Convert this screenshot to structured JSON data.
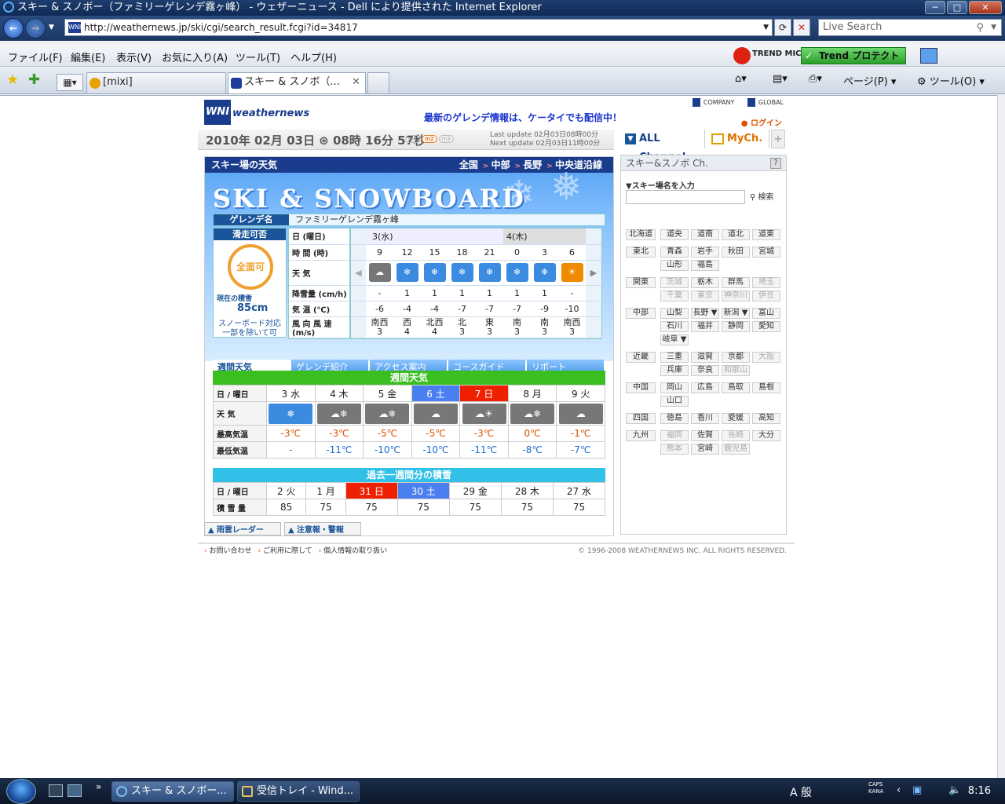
{
  "window": {
    "title": "スキー & スノボー（ファミリーゲレンデ霧ヶ峰） - ウェザーニュース - Dell により提供された Internet Explorer"
  },
  "address": {
    "url": "http://weathernews.jp/ski/cgi/search_result.fcgi?id=34817",
    "search_placeholder": "Live Search"
  },
  "menu": [
    "ファイル(F)",
    "編集(E)",
    "表示(V)",
    "お気に入り(A)",
    "ツール(T)",
    "ヘルプ(H)"
  ],
  "trend": {
    "logo": "TREND MICRO",
    "button": "Trend プロテクト™"
  },
  "tabs": [
    {
      "label": "[mixi]"
    },
    {
      "label": "スキー & スノボ（..."
    }
  ],
  "commands": {
    "page": "ページ(P)",
    "tools": "ツール(O)"
  },
  "page": {
    "logo_text": "weathernews",
    "logo_mark": "WNI",
    "top_links": [
      "COMPANY",
      "GLOBAL"
    ],
    "promo": "最新のゲレンデ情報は、ケータイでも配信中！",
    "login": "ログイン",
    "date": "2010年 02月 03日 ⊛ 08時 16分 57秒",
    "period_tags": [
      "m1",
      "m2",
      "m3"
    ],
    "last_update": "Last update  02月03日08時00分",
    "next_update": "Next update  02月03日11時00分",
    "channels": [
      "ALL Channel",
      "MyCh.",
      "+"
    ],
    "section_title": "スキー場の天気",
    "crumbs": [
      "全国",
      "中部",
      "長野",
      "中央道沿線"
    ],
    "banner_title": "SKI & SNOWBOARD",
    "resort_label": "ゲレンデ名",
    "resort_name": "ファミリーゲレンデ霧ヶ峰",
    "status_label": "滑走可否",
    "status_value": "全面可",
    "snow_label": "現在の積雪",
    "snow_value": "85cm",
    "snowboard": "スノーボード対応 一部を除いて可",
    "forecast": {
      "row_labels": [
        "日 (曜日)",
        "時 間 (時)",
        "天 気",
        "降雪量 (cm/h)",
        "気 温 (℃)",
        "風 向 風 速 (m/s)"
      ],
      "days": [
        "3(水)",
        "4(木)"
      ],
      "hours": [
        "9",
        "12",
        "15",
        "18",
        "21",
        "0",
        "3",
        "6"
      ],
      "weather": [
        "cloud",
        "snow",
        "snow",
        "snow",
        "snow",
        "snow",
        "snow",
        "sun"
      ],
      "snowfall": [
        "-",
        "1",
        "1",
        "1",
        "1",
        "1",
        "1",
        "-"
      ],
      "temp": [
        "-6",
        "-4",
        "-4",
        "-7",
        "-7",
        "-7",
        "-9",
        "-10"
      ],
      "wind_dir": [
        "南西",
        "西",
        "北西",
        "北",
        "東",
        "南",
        "南",
        "南西"
      ],
      "wind_speed": [
        "3",
        "4",
        "4",
        "3",
        "3",
        "3",
        "3",
        "3"
      ]
    },
    "sub_tabs": [
      "週間天気",
      "ゲレンデ紹介",
      "アクセス案内",
      "コースガイド",
      "リポート"
    ],
    "weekly": {
      "title": "週間天気",
      "row_labels": [
        "日 / 曜日",
        "天 気",
        "最高気温",
        "最低気温"
      ],
      "days": [
        "3 水",
        "4 木",
        "5 金",
        "6 土",
        "7 日",
        "8 月",
        "9 火"
      ],
      "weather": [
        "snow",
        "cloud-snow",
        "cloud-snow",
        "cloud",
        "cloud-sun",
        "cloud-snow",
        "cloud"
      ],
      "high": [
        "-3℃",
        "-3℃",
        "-5℃",
        "-5℃",
        "-3℃",
        "0℃",
        "-1℃"
      ],
      "low": [
        "-",
        "-11℃",
        "-10℃",
        "-10℃",
        "-11℃",
        "-8℃",
        "-7℃"
      ]
    },
    "past": {
      "title": "過去一週間分の積雪",
      "row_labels": [
        "日 / 曜日",
        "積 雪 量"
      ],
      "days": [
        "2 火",
        "1 月",
        "31 日",
        "30 土",
        "29 金",
        "28 木",
        "27 水"
      ],
      "values": [
        "85",
        "75",
        "75",
        "75",
        "75",
        "75",
        "75"
      ]
    },
    "footer_buttons": [
      "雨雲レーダー",
      "注意報・警報"
    ],
    "footer_links": [
      "お問い合わせ",
      "ご利用に際して",
      "個人情報の取り扱い"
    ],
    "copyright": "© 1996-2008 WEATHERNEWS INC. ALL RIGHTS RESERVED.",
    "side": {
      "title": "スキー&スノボ Ch.",
      "help": "?",
      "search_label": "▼スキー場名を入力",
      "search_button": "検索",
      "regions": [
        {
          "name": "北海道",
          "prefs": [
            "道央",
            "道南",
            "道北",
            "道東"
          ]
        },
        {
          "name": "東北",
          "prefs": [
            "青森",
            "岩手",
            "秋田",
            "宮城",
            "山形",
            "福島"
          ]
        },
        {
          "name": "関東",
          "prefs": [
            "茨城",
            "栃木",
            "群馬",
            "埼玉",
            "千葉",
            "東京",
            "神奈川",
            "伊豆"
          ]
        },
        {
          "name": "中部",
          "prefs": [
            "山梨",
            "長野 ▼",
            "新潟 ▼",
            "富山",
            "石川",
            "福井",
            "静岡",
            "愛知",
            "岐阜 ▼"
          ]
        },
        {
          "name": "近畿",
          "prefs": [
            "三重",
            "滋賀",
            "京都",
            "大阪",
            "兵庫",
            "奈良",
            "和歌山"
          ]
        },
        {
          "name": "中国",
          "prefs": [
            "岡山",
            "広島",
            "鳥取",
            "島根",
            "山口"
          ]
        },
        {
          "name": "四国",
          "prefs": [
            "徳島",
            "香川",
            "愛媛",
            "高知"
          ]
        },
        {
          "name": "九州",
          "prefs": [
            "福岡",
            "佐賀",
            "長崎",
            "大分",
            "熊本",
            "宮崎",
            "鹿児島"
          ]
        }
      ]
    }
  },
  "taskbar": {
    "buttons": [
      "スキー & スノボー...",
      "受信トレイ - Wind..."
    ],
    "ime": "A 般",
    "caps": "CAPS KANA",
    "clock": "8:16"
  }
}
